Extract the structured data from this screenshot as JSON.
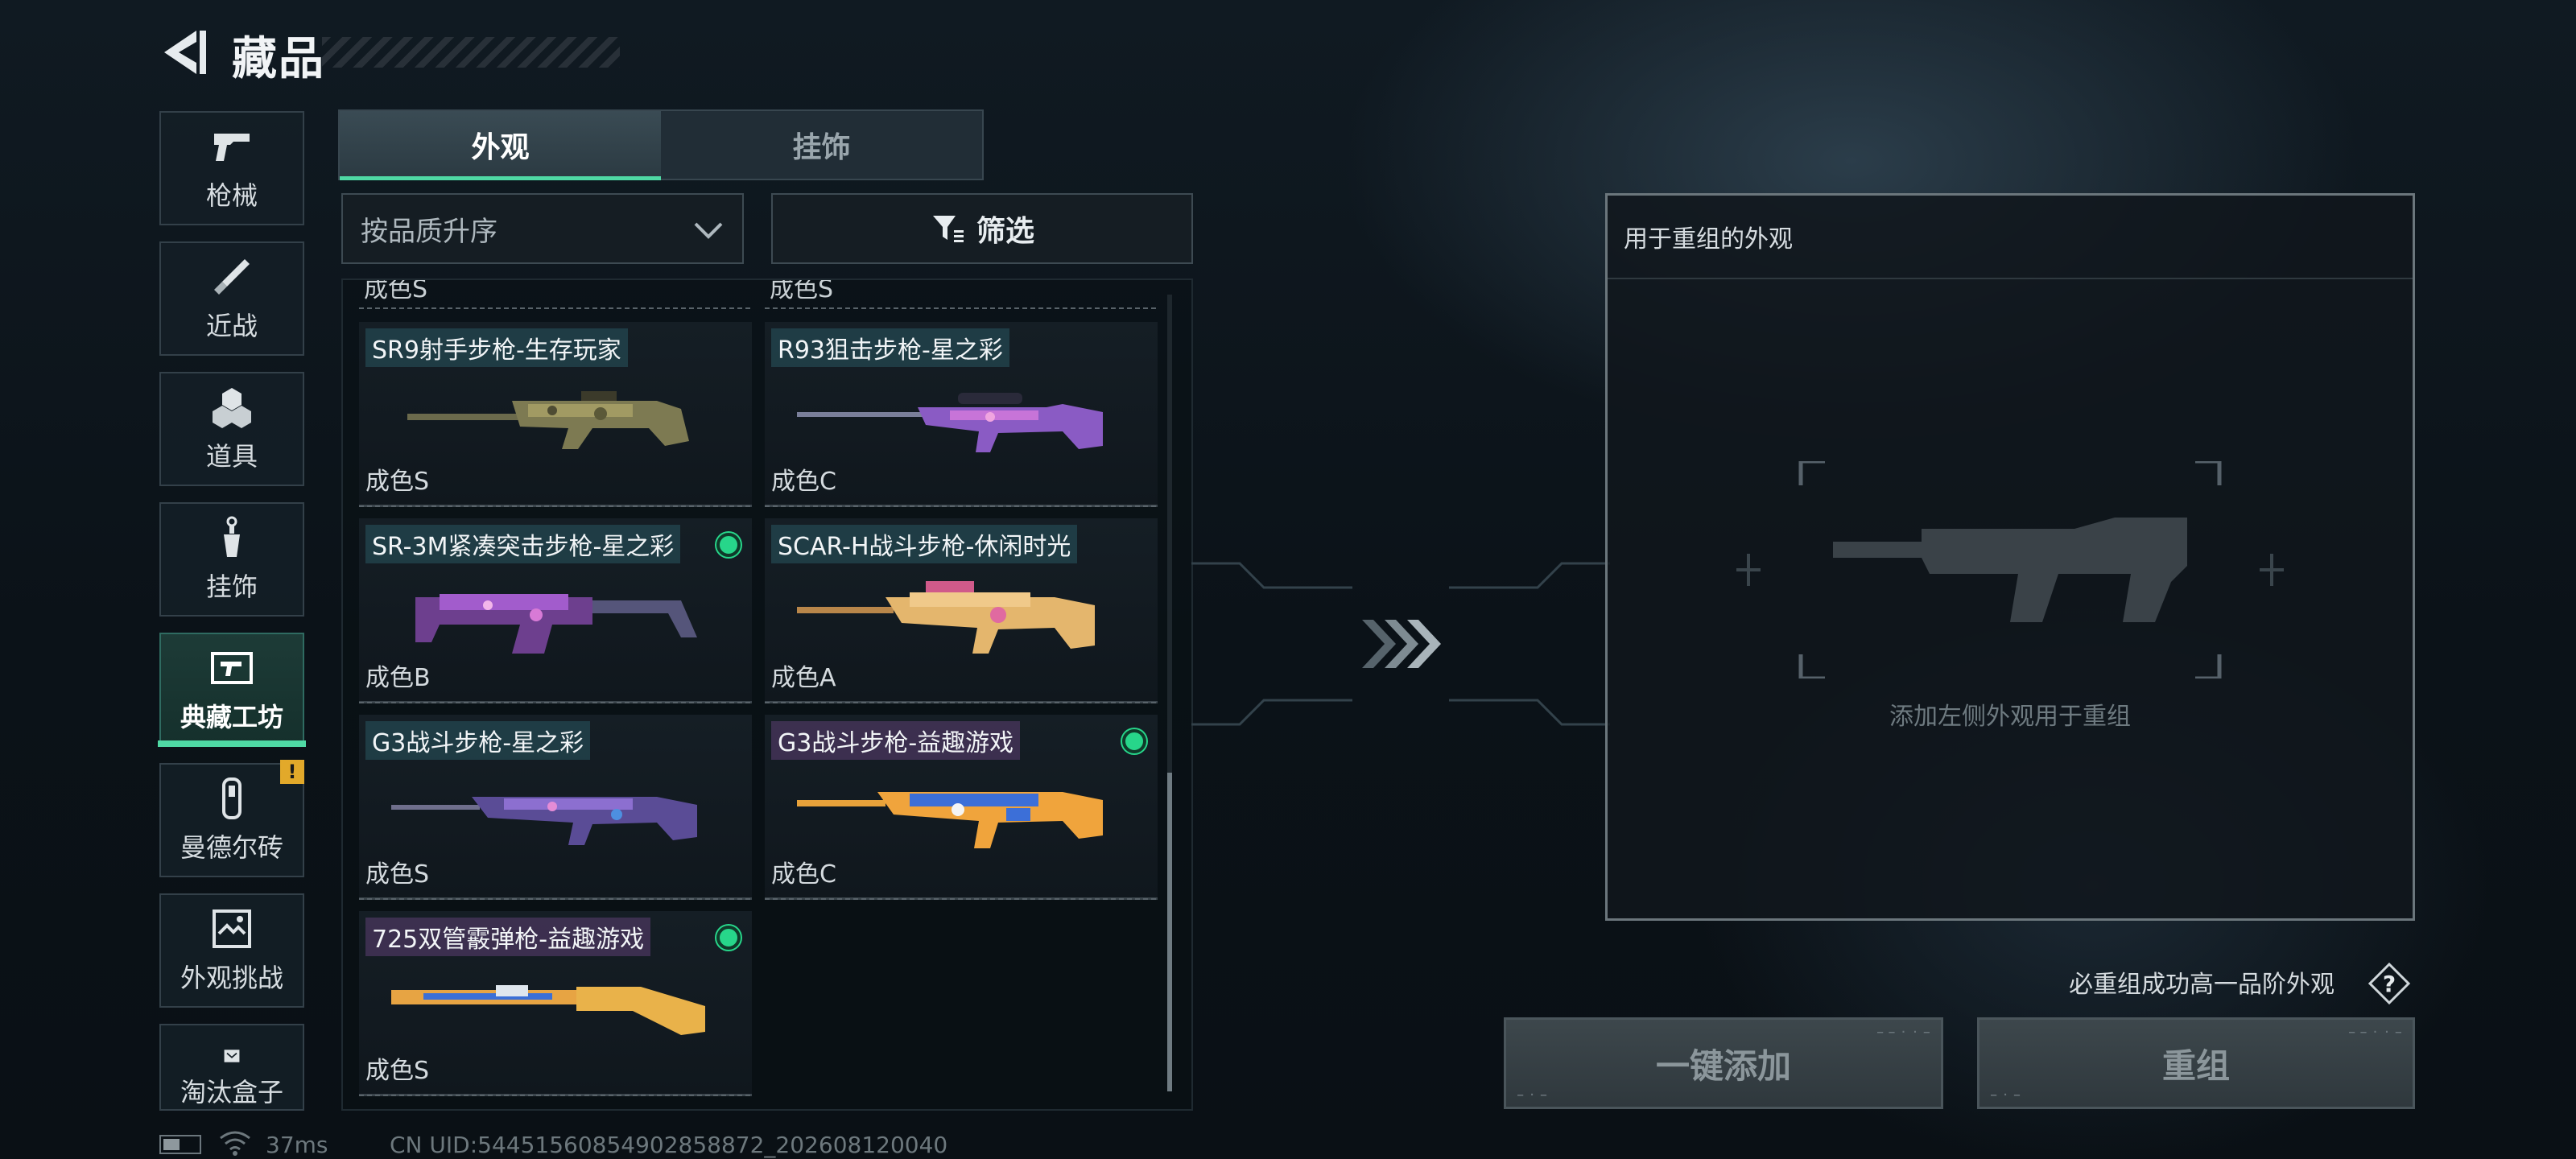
{
  "header": {
    "title": "藏品"
  },
  "sidebar": {
    "items": [
      {
        "label": "枪械",
        "icon": "pistol-icon"
      },
      {
        "label": "近战",
        "icon": "knife-icon"
      },
      {
        "label": "道具",
        "icon": "grenades-icon"
      },
      {
        "label": "挂饰",
        "icon": "charm-icon"
      },
      {
        "label": "典藏工坊",
        "icon": "workshop-icon",
        "active": true
      },
      {
        "label": "曼德尔砖",
        "icon": "mandel-brick-icon",
        "alert": "!"
      },
      {
        "label": "外观挑战",
        "icon": "challenge-icon"
      },
      {
        "label": "淘汰盒子",
        "icon": "box-icon"
      }
    ]
  },
  "tabs": [
    {
      "label": "外观",
      "active": true
    },
    {
      "label": "挂饰",
      "active": false
    }
  ],
  "sort": {
    "selected": "按品质升序"
  },
  "filter": {
    "label": "筛选"
  },
  "list": {
    "clipped_row": {
      "left": "成色S",
      "right": "成色S"
    },
    "items": [
      {
        "name": "SR9射手步枪-生存玩家",
        "grade": "成色S",
        "badge": false
      },
      {
        "name": "R93狙击步枪-星之彩",
        "grade": "成色C",
        "badge": false
      },
      {
        "name": "SR-3M紧凑突击步枪-星之彩",
        "grade": "成色B",
        "badge": true
      },
      {
        "name": "SCAR-H战斗步枪-休闲时光",
        "grade": "成色A",
        "badge": false
      },
      {
        "name": "G3战斗步枪-星之彩",
        "grade": "成色S",
        "badge": false
      },
      {
        "name": "G3战斗步枪-益趣游戏",
        "grade": "成色C",
        "badge": true
      },
      {
        "name": "725双管霰弹枪-益趣游戏",
        "grade": "成色S",
        "badge": true
      }
    ]
  },
  "recombine": {
    "title": "用于重组的外观",
    "hint": "添加左侧外观用于重组",
    "note": "必重组成功高一品阶外观",
    "one_click_add": "一键添加",
    "recombine": "重组"
  },
  "status": {
    "ping": "37ms",
    "uid": "CN UID:5445156085490285887​2_202608120040"
  },
  "colors": {
    "accent": "#4fd9a4",
    "badge": "#27d68a",
    "alert": "#e2a92a"
  }
}
